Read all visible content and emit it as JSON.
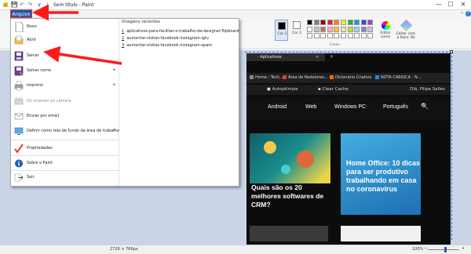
{
  "window": {
    "title": "Sem título - Paint",
    "qa_save": "💾",
    "qa_undo": "↶",
    "qa_redo": "↷",
    "qa_custom": "∨",
    "minimize": "—",
    "maximize": "☐",
    "close": "✕"
  },
  "ribbon": {
    "file_tab": "Arquivo",
    "cor1_label": "Cor 1",
    "cor2_label": "Cor 2",
    "cores_group": "Cores",
    "edit_colors": "Editar cores",
    "edit_paint3d": "Editar com o Paint 3D",
    "palette": [
      "#000000",
      "#7f7f7f",
      "#880015",
      "#ed1c24",
      "#ff7f27",
      "#fff200",
      "#22b14c",
      "#00a2e8",
      "#3f48cc",
      "#a349a4",
      "#ffffff",
      "#c3c3c3",
      "#b97a57",
      "#ffaec9",
      "#ffc90e",
      "#efe4b0",
      "#b5e61d",
      "#99d9ea",
      "#7092be",
      "#c8bfe7",
      "#ffffff",
      "#ffffff",
      "#ffffff",
      "#ffffff",
      "#ffffff",
      "#ffffff",
      "#ffffff",
      "#ffffff",
      "#ffffff",
      "#ffffff"
    ],
    "help": "?"
  },
  "file_menu": {
    "items": [
      {
        "label": "Novo",
        "icon": "new-file-icon"
      },
      {
        "label": "Abrir",
        "icon": "open-folder-icon"
      },
      {
        "label": "Salvar",
        "icon": "save-icon"
      },
      {
        "label": "Salvar como",
        "icon": "save-as-icon"
      },
      {
        "label": "Imprimir",
        "icon": "print-icon"
      },
      {
        "label": "Do scanner ou câmera",
        "icon": "scanner-icon"
      },
      {
        "label": "Enviar por email",
        "icon": "email-icon"
      },
      {
        "label": "Definir como tela de fundo da área de trabalho",
        "icon": "desktop-background-icon"
      },
      {
        "label": "Propriedades",
        "icon": "properties-icon"
      },
      {
        "label": "Sobre o Paint",
        "icon": "about-icon"
      },
      {
        "label": "Sair",
        "icon": "exit-icon"
      }
    ],
    "recent_title": "Imagens recentes",
    "recent": [
      {
        "num": "1",
        "name": "aplicativos-para-facilitar-o-trabalho-de-designer-flipboard"
      },
      {
        "num": "2",
        "name": "aumentar-visitas-facebook-instagram-igtv"
      },
      {
        "num": "3",
        "name": "aumentar-visitas-facebook-instagram-spam"
      }
    ]
  },
  "browser": {
    "tab": "- Aplicativos",
    "tab_close": "×",
    "new_tab": "+",
    "bookmarks": [
      "Home › Tecli...",
      "Área de Redatores...",
      "Dicionário Criativo",
      "NOTA CARIOCA - N..."
    ],
    "bookmark_colors": [
      "#888888",
      "#e53935",
      "#ef6c00",
      "#1e88e5"
    ],
    "toolbar": [
      "Autoptimize",
      "Clear Cache",
      "Olá, Filipe Salles"
    ],
    "nav": [
      "Android",
      "Web",
      "Windows PC",
      "Português"
    ],
    "search_icon": "🔍",
    "card1_title": "Quais são os 20 melhores softwares de CRM?",
    "card2_title": "Home Office: 10 dicas para ser produtivo trabalhando em casa no coronavírus"
  },
  "status": {
    "dimensions": "2726 × 766px",
    "zoom": "100%",
    "zoom_minus": "—",
    "zoom_plus": "+"
  }
}
